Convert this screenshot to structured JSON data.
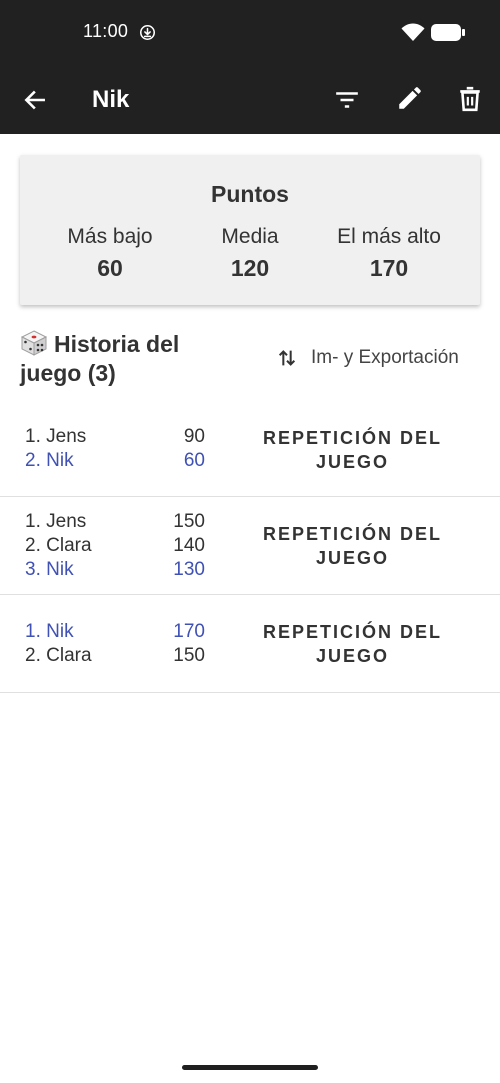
{
  "status": {
    "time": "11:00"
  },
  "appbar": {
    "title": "Nik"
  },
  "stats": {
    "title": "Puntos",
    "items": [
      {
        "label": "Más bajo",
        "value": "60"
      },
      {
        "label": "Media",
        "value": "120"
      },
      {
        "label": "El más alto",
        "value": "170"
      }
    ]
  },
  "history": {
    "title": "Historia del juego (3)",
    "impexp_label": "Im- y Exportación",
    "replay_label_line1": "REPETICIÓN DEL",
    "replay_label_line2": "JUEGO",
    "games": [
      {
        "rows": [
          {
            "name": "1. Jens",
            "score": "90"
          },
          {
            "name": "2. Nik",
            "score": "60"
          }
        ]
      },
      {
        "rows": [
          {
            "name": "1. Jens",
            "score": "150"
          },
          {
            "name": "2. Clara",
            "score": "140"
          },
          {
            "name": "3. Nik",
            "score": "130"
          }
        ]
      },
      {
        "rows": [
          {
            "name": "1. Nik",
            "score": "170"
          },
          {
            "name": "2. Clara",
            "score": "150"
          }
        ]
      }
    ]
  },
  "colors": {
    "bar": "#212121",
    "highlight": "#3f51b5",
    "card": "#f0f0f0"
  }
}
